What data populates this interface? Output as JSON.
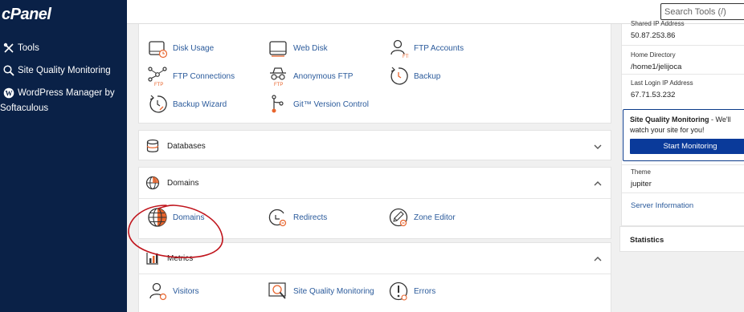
{
  "sidebar": {
    "logo": "cPanel",
    "items": [
      {
        "label": "Tools",
        "icon": "tools-icon"
      },
      {
        "label": "Site Quality Monitoring",
        "icon": "magnifier-icon"
      },
      {
        "label": "WordPress Manager by",
        "label2": "Softaculous",
        "icon": "wordpress-icon"
      }
    ]
  },
  "topbar": {
    "search_placeholder": "Search Tools (/)"
  },
  "files": {
    "items": [
      {
        "label": "Disk Usage",
        "icon": "disk-usage-icon"
      },
      {
        "label": "Web Disk",
        "icon": "web-disk-icon"
      },
      {
        "label": "FTP Accounts",
        "icon": "ftp-accounts-icon"
      },
      {
        "label": "FTP Connections",
        "icon": "ftp-connections-icon"
      },
      {
        "label": "Anonymous FTP",
        "icon": "anonymous-ftp-icon"
      },
      {
        "label": "Backup",
        "icon": "backup-icon"
      },
      {
        "label": "Backup Wizard",
        "icon": "backup-wizard-icon"
      },
      {
        "label": "Git™ Version Control",
        "icon": "git-icon"
      }
    ]
  },
  "databases": {
    "title": "Databases"
  },
  "domains": {
    "title": "Domains",
    "items": [
      {
        "label": "Domains",
        "icon": "domains-globe-icon"
      },
      {
        "label": "Redirects",
        "icon": "redirects-icon"
      },
      {
        "label": "Zone Editor",
        "icon": "zone-editor-icon"
      }
    ]
  },
  "metrics": {
    "title": "Metrics",
    "items": [
      {
        "label": "Visitors",
        "icon": "visitors-icon"
      },
      {
        "label": "Site Quality Monitoring",
        "icon": "site-quality-icon"
      },
      {
        "label": "Errors",
        "icon": "errors-icon"
      }
    ]
  },
  "info": {
    "shared_ip_label": "Shared IP Address",
    "shared_ip_value": "50.87.253.86",
    "home_dir_label": "Home Directory",
    "home_dir_value": "/home1/jelijoca",
    "last_login_label": "Last Login IP Address",
    "last_login_value": "67.71.53.232",
    "sqm_title": "Site Quality Monitoring",
    "sqm_text": " - We'll watch your site for you!",
    "sqm_button": "Start Monitoring",
    "theme_label": "Theme",
    "theme_value": "jupiter",
    "server_info": "Server Information",
    "statistics": "Statistics"
  },
  "colors": {
    "sidebar_bg": "#0a2147",
    "link": "#2a5a9b",
    "accent_orange": "#e8642c",
    "button_blue": "#0a3a9a",
    "annotation_red": "#c0141c"
  }
}
